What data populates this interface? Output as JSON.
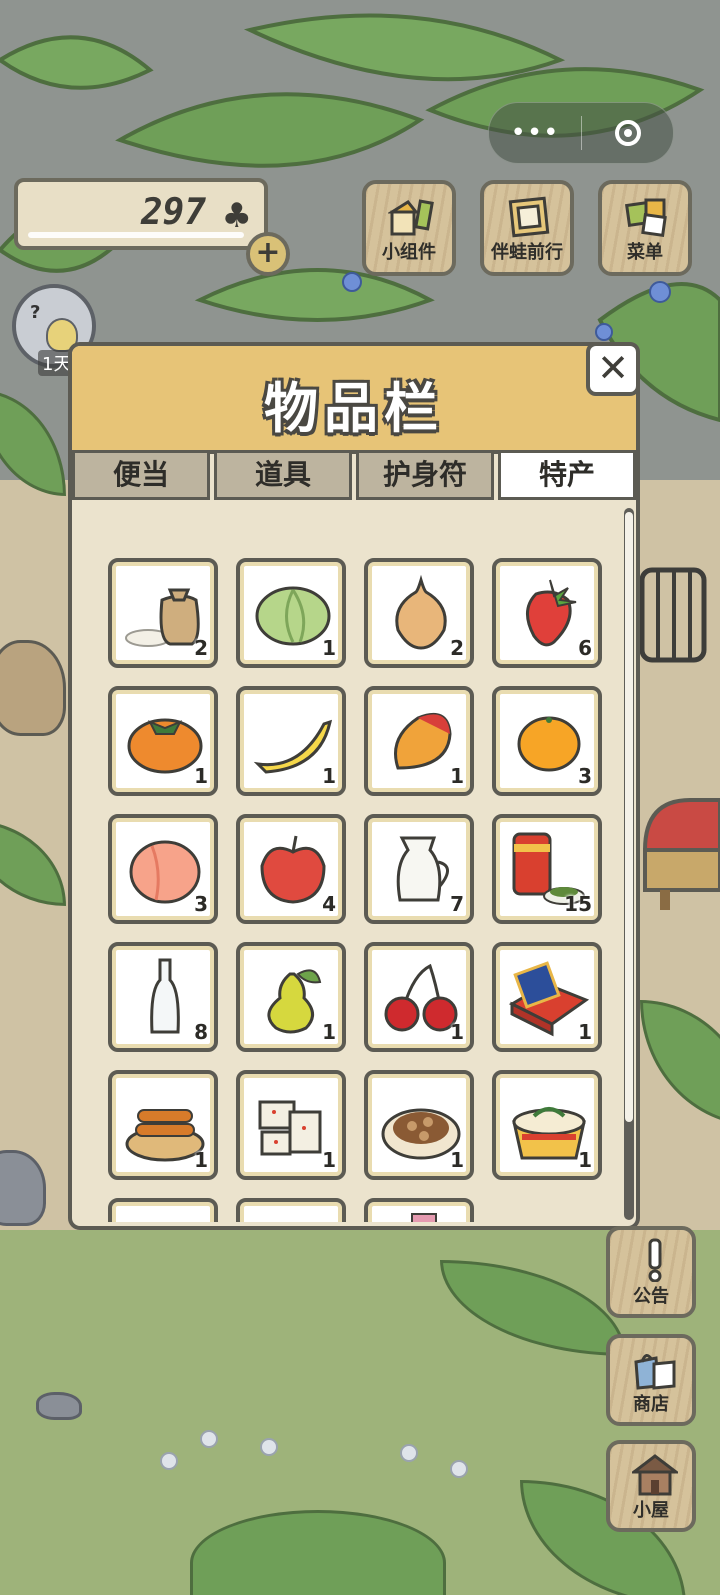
{
  "hud": {
    "clover_count": "297",
    "clover_icon": "clover-icon",
    "plus_label": "+",
    "day_label": "1天",
    "avatar_badge": "?"
  },
  "mini_program": {
    "more_label": "•••",
    "target_icon": "target-icon"
  },
  "top_buttons": [
    {
      "label": "小组件",
      "icon": "widget-icon"
    },
    {
      "label": "伴蛙前行",
      "icon": "frame-icon"
    },
    {
      "label": "菜单",
      "icon": "menu-icon"
    }
  ],
  "inventory": {
    "title": "物品栏",
    "close_label": "✕",
    "tabs": [
      {
        "label": "便当",
        "active": false
      },
      {
        "label": "道具",
        "active": false
      },
      {
        "label": "护身符",
        "active": false
      },
      {
        "label": "特产",
        "active": true
      }
    ],
    "items": [
      {
        "icon": "rice-sack-icon",
        "qty": "2"
      },
      {
        "icon": "cabbage-icon",
        "qty": "1"
      },
      {
        "icon": "onion-icon",
        "qty": "2"
      },
      {
        "icon": "strawberry-icon",
        "qty": "6"
      },
      {
        "icon": "persimmon-icon",
        "qty": "1"
      },
      {
        "icon": "banana-icon",
        "qty": "1"
      },
      {
        "icon": "mango-icon",
        "qty": "1"
      },
      {
        "icon": "orange-icon",
        "qty": "3"
      },
      {
        "icon": "peach-icon",
        "qty": "3"
      },
      {
        "icon": "apple-icon",
        "qty": "4"
      },
      {
        "icon": "milk-jug-icon",
        "qty": "7"
      },
      {
        "icon": "tea-can-icon",
        "qty": "15"
      },
      {
        "icon": "glass-bottle-icon",
        "qty": "8"
      },
      {
        "icon": "pear-icon",
        "qty": "1"
      },
      {
        "icon": "cherry-icon",
        "qty": "1"
      },
      {
        "icon": "mooncake-box-icon",
        "qty": "1"
      },
      {
        "icon": "fried-dough-icon",
        "qty": "1"
      },
      {
        "icon": "nougat-icon",
        "qty": "1"
      },
      {
        "icon": "nuts-plate-icon",
        "qty": "1"
      },
      {
        "icon": "noodle-bowl-icon",
        "qty": "1"
      }
    ]
  },
  "side_buttons": [
    {
      "label": "公告",
      "icon": "exclamation-icon"
    },
    {
      "label": "商店",
      "icon": "shop-bags-icon"
    },
    {
      "label": "小屋",
      "icon": "house-icon"
    }
  ],
  "colors": {
    "panel_header": "#e7c477",
    "panel_body": "#ebe3cd",
    "tab_inactive": "#bdb49f",
    "tab_active": "#ffffff",
    "outline": "#5c5b53"
  }
}
